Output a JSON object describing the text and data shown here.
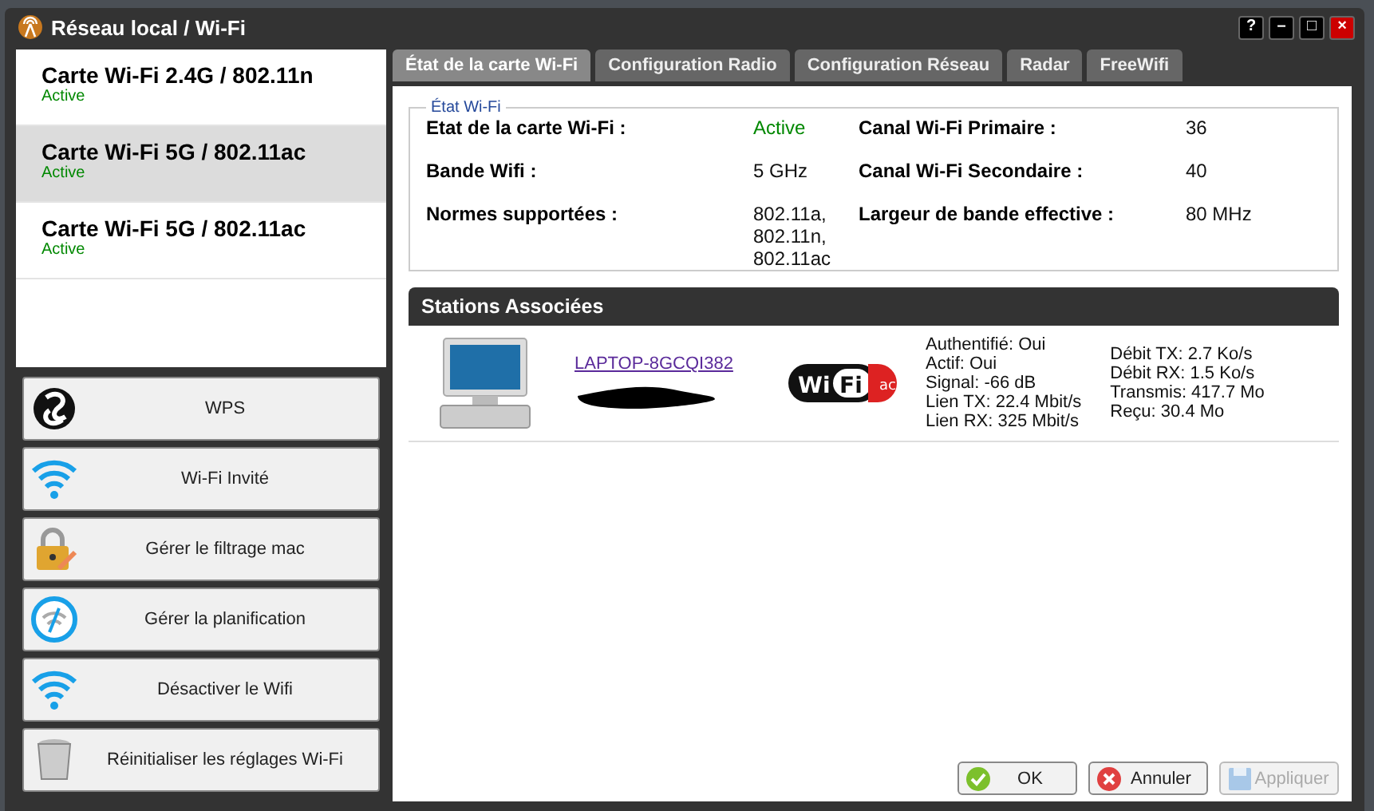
{
  "window": {
    "title": "Réseau local / Wi-Fi",
    "controls": [
      "?",
      "–",
      "□",
      "×"
    ]
  },
  "cards": [
    {
      "name": "Carte Wi-Fi 2.4G / 802.11n",
      "status": "Active",
      "selected": false
    },
    {
      "name": "Carte Wi-Fi 5G / 802.11ac",
      "status": "Active",
      "selected": true
    },
    {
      "name": "Carte Wi-Fi 5G / 802.11ac",
      "status": "Active",
      "selected": false
    }
  ],
  "actions": [
    {
      "label": "WPS",
      "kind": "wps"
    },
    {
      "label": "Wi-Fi Invité",
      "kind": "wifi"
    },
    {
      "label": "Gérer le filtrage mac",
      "kind": "lock"
    },
    {
      "label": "Gérer la planification",
      "kind": "clock"
    },
    {
      "label": "Désactiver le Wifi",
      "kind": "wifi"
    },
    {
      "label": "Réinitialiser les réglages Wi-Fi",
      "kind": "trash"
    }
  ],
  "tabs": [
    {
      "label": "État de la carte Wi-Fi",
      "selected": true
    },
    {
      "label": "Configuration Radio",
      "selected": false
    },
    {
      "label": "Configuration Réseau",
      "selected": false
    },
    {
      "label": "Radar",
      "selected": false
    },
    {
      "label": "FreeWifi",
      "selected": false
    }
  ],
  "etat": {
    "legend": "État Wi-Fi",
    "left": [
      {
        "label": "Etat de la carte Wi-Fi :",
        "value": [
          "Active"
        ],
        "kind": "status"
      },
      {
        "label": "Bande Wifi :",
        "value": [
          "5 GHz"
        ],
        "kind": "text"
      },
      {
        "label": "Normes supportées :",
        "value": [
          "802.11a,",
          "802.11n,",
          "802.11ac"
        ],
        "kind": "text"
      }
    ],
    "right": [
      {
        "label": "Canal Wi-Fi Primaire :",
        "value": "36"
      },
      {
        "label": "Canal Wi-Fi Secondaire :",
        "value": "40"
      },
      {
        "label": "Largeur de bande effective :",
        "value": "80 MHz"
      }
    ]
  },
  "stations": {
    "title": "Stations Associées",
    "rows": [
      {
        "name": "LAPTOP-8GCQI382",
        "logo_text": [
          "Wi",
          "Fi"
        ],
        "standard_badge": "ac",
        "info": [
          "Authentifié: Oui",
          "Actif: Oui",
          "Signal: -66 dB",
          "Lien TX: 22.4 Mbit/s",
          "Lien RX: 325 Mbit/s"
        ],
        "traffic": [
          "Débit TX: 2.7 Ko/s",
          "Débit RX: 1.5 Ko/s",
          "Transmis: 417.7 Mo",
          "Reçu: 30.4 Mo"
        ]
      }
    ]
  },
  "footer": [
    {
      "label": "OK",
      "kind": "ok",
      "disabled": false
    },
    {
      "label": "Annuler",
      "kind": "cancel",
      "disabled": false
    },
    {
      "label": "Appliquer",
      "kind": "apply",
      "disabled": true
    }
  ]
}
